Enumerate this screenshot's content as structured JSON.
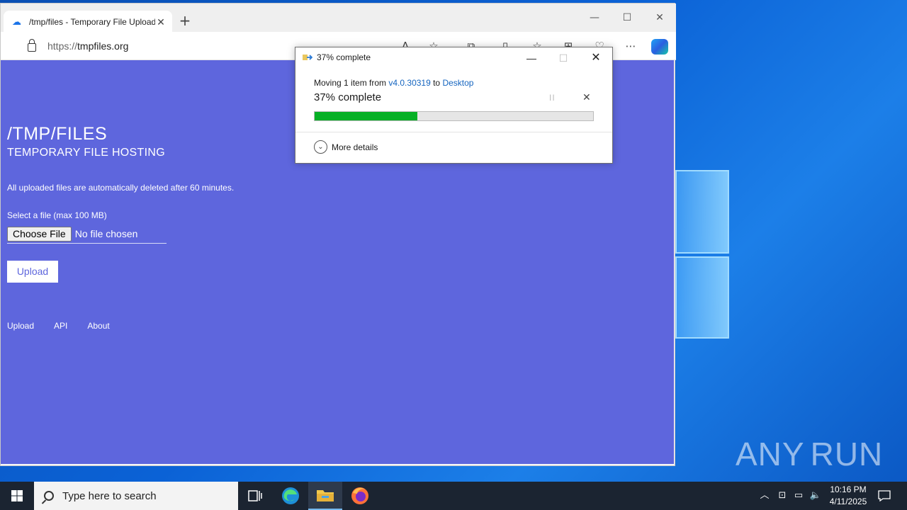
{
  "browser": {
    "tab_title": "/tmp/files - Temporary File Upload",
    "new_tab": "+",
    "window_controls": {
      "minimize": "—",
      "maximize": "☐",
      "close": "✕"
    },
    "url_protocol": "https://",
    "url_host": "tmpfiles.org",
    "toolbar_icons": [
      "read-aloud-icon",
      "favorite-star-icon",
      "extensions-icon",
      "split-screen-icon",
      "favorites-icon",
      "collections-icon",
      "browser-essentials-icon",
      "more-icon",
      "copilot-icon"
    ]
  },
  "site": {
    "title": "/TMP/FILES",
    "subtitle": "TEMPORARY FILE HOSTING",
    "notice": "All uploaded files are automatically deleted after 60 minutes.",
    "file_label": "Select a file (max 100 MB)",
    "choose_file": "Choose File",
    "no_file": "No file chosen",
    "upload_button": "Upload",
    "nav": [
      "Upload",
      "API",
      "About"
    ],
    "background_color": "#5e66dd"
  },
  "dialog": {
    "title": "37% complete",
    "moving_prefix": "Moving 1 item from ",
    "source": "v4.0.30319",
    "moving_mid": " to ",
    "destination": "Desktop",
    "percent_text": "37% complete",
    "progress": 0.37,
    "pause_symbol": "II",
    "cancel_symbol": "✕",
    "more_details": "More details",
    "progress_color": "#06b025"
  },
  "taskbar": {
    "search_placeholder": "Type here to search",
    "apps": [
      "task-view-icon",
      "edge-icon",
      "file-explorer-icon",
      "firefox-icon"
    ],
    "time": "10:16 PM",
    "date": "4/11/2025"
  },
  "watermark": {
    "left": "ANY",
    "right": "RUN"
  }
}
